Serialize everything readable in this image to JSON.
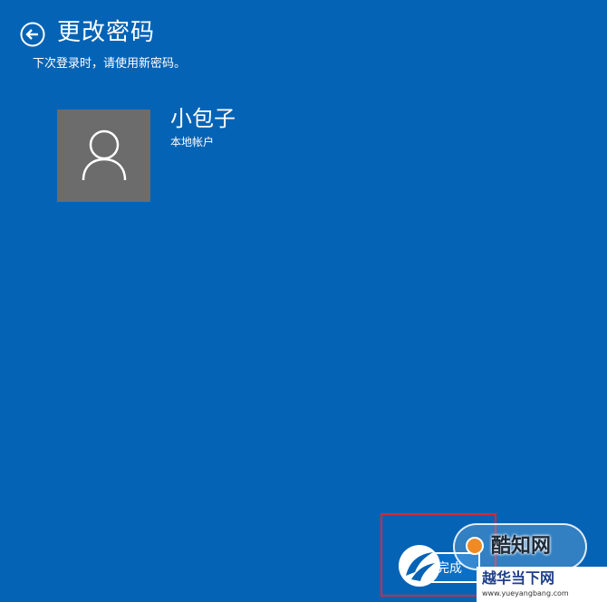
{
  "header": {
    "title": "更改密码",
    "subtitle": "下次登录时，请使用新密码。",
    "back_icon": "back-arrow-icon"
  },
  "account": {
    "user_name": "小包子",
    "account_type": "本地帐户",
    "avatar_icon": "user-icon"
  },
  "footer": {
    "finish_label": "完成"
  },
  "watermark": {
    "brand": "酷知网",
    "site_name": "越华当下网",
    "site_url": "www.yueyangbang.com"
  },
  "colors": {
    "background": "#0563b5",
    "avatar": "#6c6c6c",
    "highlight": "#d22a3a",
    "text": "#ffffff"
  }
}
